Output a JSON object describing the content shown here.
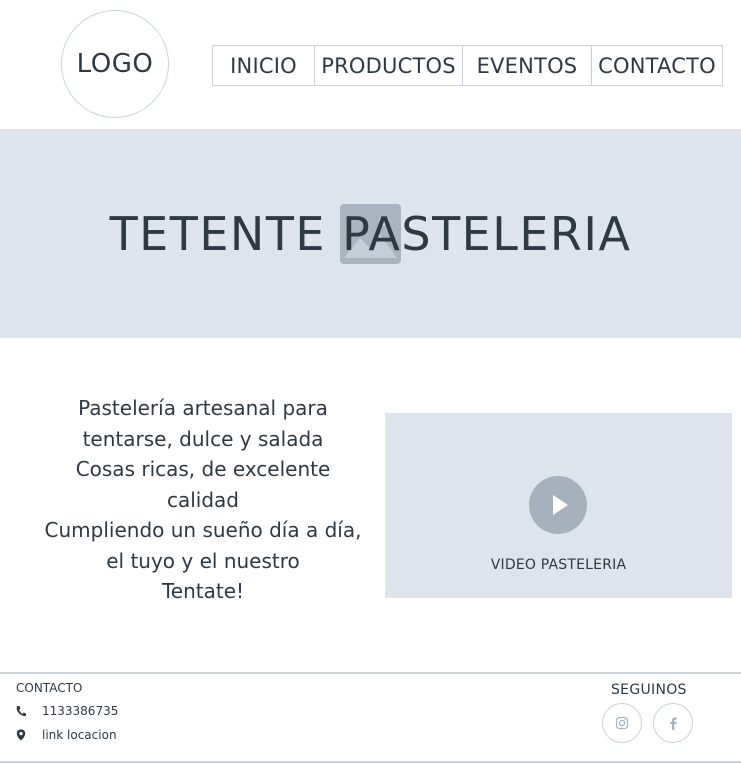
{
  "header": {
    "logo_text": "LOGO",
    "nav": [
      {
        "label": "INICIO"
      },
      {
        "label": "PRODUCTOS"
      },
      {
        "label": "EVENTOS"
      },
      {
        "label": "CONTACTO"
      }
    ]
  },
  "hero": {
    "title": "TETENTE PASTELERIA",
    "image_icon": "image-placeholder-icon"
  },
  "description": {
    "lines": [
      "Pastelería artesanal para",
      "tentarse, dulce y salada",
      "Cosas ricas, de excelente",
      "calidad",
      "Cumpliendo un sueño día a día,",
      "el tuyo y el nuestro",
      "Tentate!"
    ]
  },
  "video": {
    "label": "VIDEO PASTELERIA",
    "icon": "play-icon"
  },
  "footer": {
    "contact_title": "CONTACTO",
    "phone": "1133386735",
    "location_link": "link locacion",
    "follow_title": "SEGUINOS",
    "social": [
      "instagram-icon",
      "facebook-icon"
    ]
  },
  "colors": {
    "text": "#2e3943",
    "border": "#c9d3dd",
    "panel": "#dde4eb",
    "icon_fill": "#a5b1bd"
  }
}
